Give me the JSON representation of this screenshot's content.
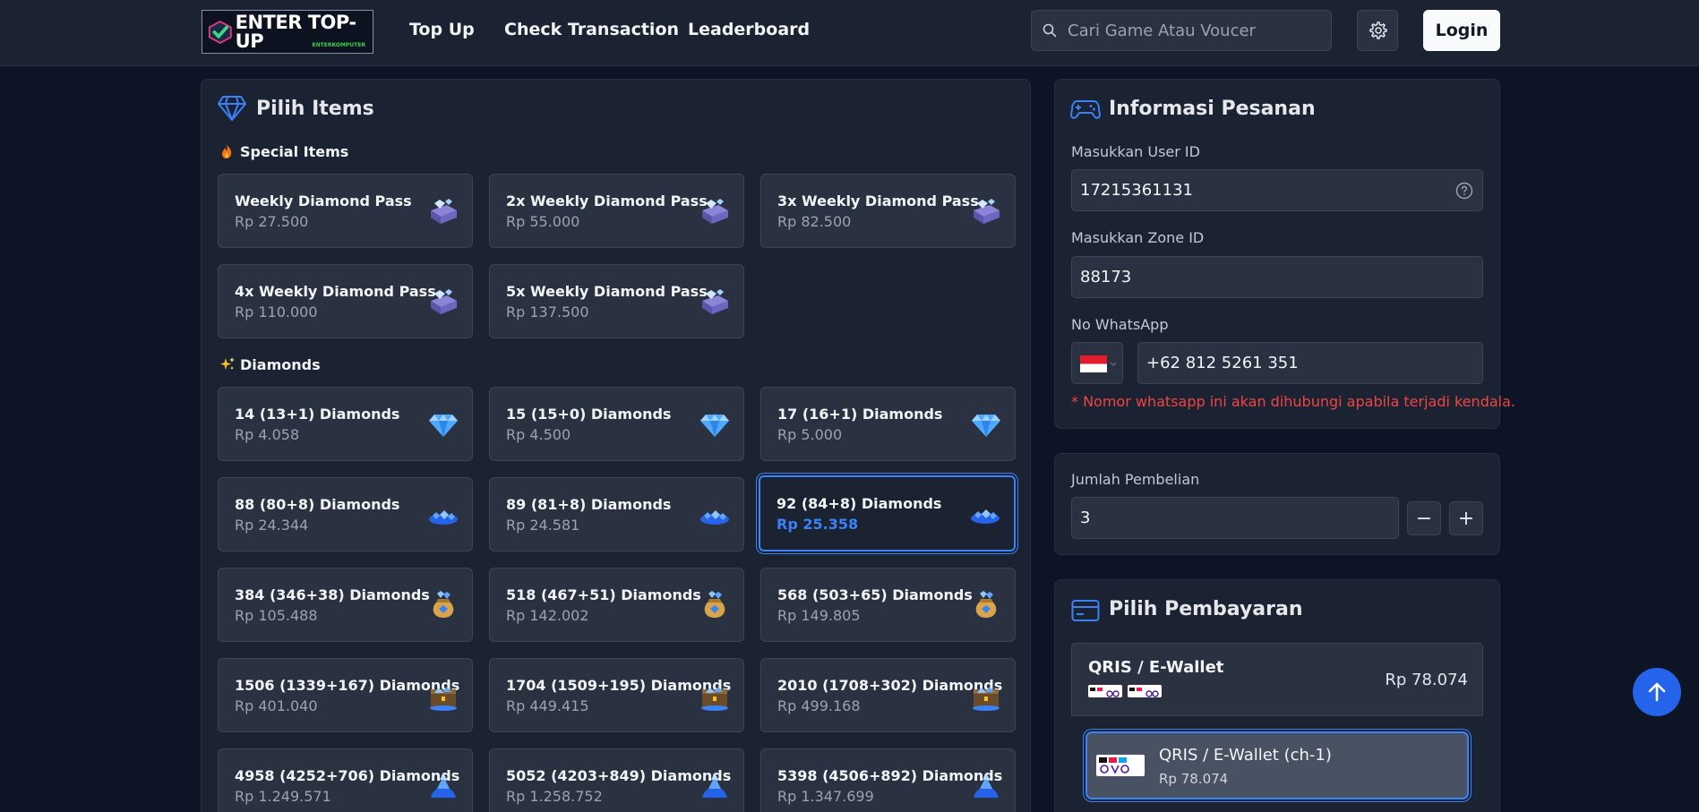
{
  "header": {
    "logo_text": "ENTER TOP-UP",
    "logo_sub": "ENTERKOMPUTER",
    "nav": [
      "Top Up",
      "Check Transaction",
      "Leaderboard"
    ],
    "search_placeholder": "Cari Game Atau Voucer",
    "login_label": "Login"
  },
  "items_panel": {
    "title": "Pilih Items",
    "special_label": "Special Items",
    "diamonds_label": "Diamonds",
    "special_items": [
      {
        "name": "Weekly Diamond Pass",
        "price": "Rp 27.500"
      },
      {
        "name": "2x Weekly Diamond Pass",
        "price": "Rp 55.000"
      },
      {
        "name": "3x Weekly Diamond Pass",
        "price": "Rp 82.500"
      },
      {
        "name": "4x Weekly Diamond Pass",
        "price": "Rp 110.000"
      },
      {
        "name": "5x Weekly Diamond Pass",
        "price": "Rp 137.500"
      }
    ],
    "diamonds": [
      {
        "name": "14 (13+1) Diamonds",
        "price": "Rp 4.058"
      },
      {
        "name": "15 (15+0) Diamonds",
        "price": "Rp 4.500"
      },
      {
        "name": "17 (16+1) Diamonds",
        "price": "Rp 5.000"
      },
      {
        "name": "88 (80+8) Diamonds",
        "price": "Rp 24.344"
      },
      {
        "name": "89 (81+8) Diamonds",
        "price": "Rp 24.581"
      },
      {
        "name": "92 (84+8) Diamonds",
        "price": "Rp 25.358"
      },
      {
        "name": "384 (346+38) Diamonds",
        "price": "Rp 105.488"
      },
      {
        "name": "518 (467+51) Diamonds",
        "price": "Rp 142.002"
      },
      {
        "name": "568 (503+65) Diamonds",
        "price": "Rp 149.805"
      },
      {
        "name": "1506 (1339+167) Diamonds",
        "price": "Rp 401.040"
      },
      {
        "name": "1704 (1509+195) Diamonds",
        "price": "Rp 449.415"
      },
      {
        "name": "2010 (1708+302) Diamonds",
        "price": "Rp 499.168"
      },
      {
        "name": "4958 (4252+706) Diamonds",
        "price": "Rp 1.249.571"
      },
      {
        "name": "5052 (4203+849) Diamonds",
        "price": "Rp 1.258.752"
      },
      {
        "name": "5398 (4506+892) Diamonds",
        "price": "Rp 1.347.699"
      }
    ]
  },
  "order_panel": {
    "title": "Informasi Pesanan",
    "user_id_label": "Masukkan User ID",
    "user_id_value": "17215361131",
    "zone_id_label": "Masukkan Zone ID",
    "zone_id_value": "88173",
    "whatsapp_label": "No WhatsApp",
    "whatsapp_value": "+62 812 5261 351",
    "whatsapp_note": "* Nomor whatsapp ini akan dihubungi apabila terjadi kendala."
  },
  "quantity_panel": {
    "label": "Jumlah Pembelian",
    "value": "3",
    "minus": "−",
    "plus": "+"
  },
  "payment_panel": {
    "title": "Pilih Pembayaran",
    "group_name": "QRIS / E-Wallet",
    "group_price": "Rp 78.074",
    "option_name": "QRIS / E-Wallet (ch-1)",
    "option_price": "Rp 78.074"
  },
  "colors": {
    "accent": "#3b82f6",
    "background": "#0c1426",
    "panel": "#1b2333",
    "warning": "#ef4444"
  }
}
